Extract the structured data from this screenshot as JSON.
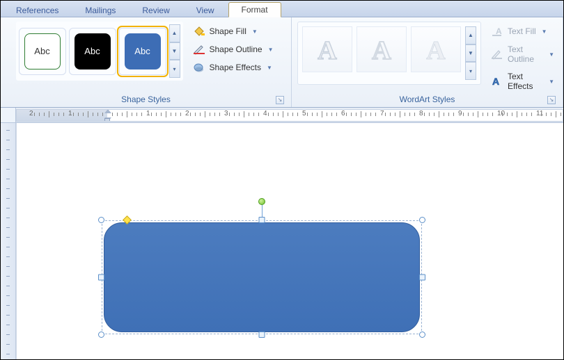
{
  "tabs": {
    "references": "References",
    "mailings": "Mailings",
    "review": "Review",
    "view": "View",
    "format": "Format"
  },
  "shape_styles": {
    "group_label": "Shape Styles",
    "thumb_text": "Abc",
    "fill": "Shape Fill",
    "outline": "Shape Outline",
    "effects": "Shape Effects"
  },
  "wordart_styles": {
    "group_label": "WordArt Styles",
    "letter": "A",
    "text_fill": "Text Fill",
    "text_outline": "Text Outline",
    "text_effects": "Text Effects"
  },
  "ruler": {
    "labels": [
      "2",
      "1",
      "",
      "1",
      "2",
      "3",
      "4",
      "5",
      "6",
      "7",
      "8",
      "9",
      "10",
      "11"
    ]
  }
}
